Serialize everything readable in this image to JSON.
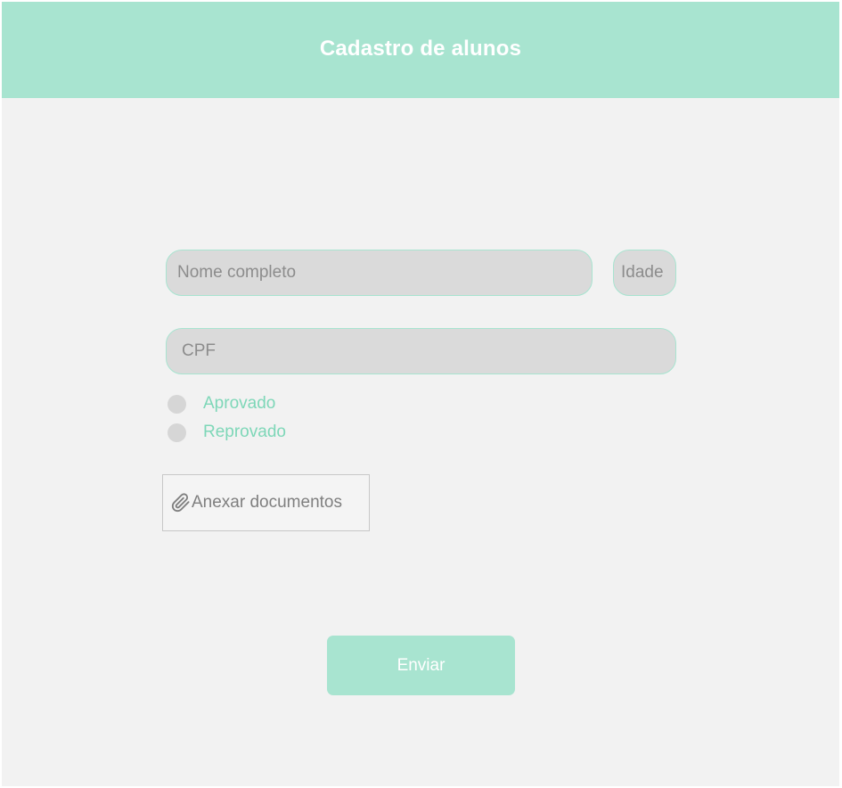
{
  "header": {
    "title": "Cadastro de alunos"
  },
  "form": {
    "name_placeholder": "Nome completo",
    "name_value": "",
    "age_placeholder": "Idade",
    "age_value": "",
    "cpf_placeholder": "CPF",
    "cpf_value": "",
    "status_options": [
      {
        "label": "Aprovado",
        "selected": false
      },
      {
        "label": "Reprovado",
        "selected": false
      }
    ],
    "attach_label": "Anexar documentos",
    "attach_icon": "paperclip-icon",
    "submit_label": "Enviar"
  },
  "colors": {
    "accent": "#a8e4d0",
    "accent_text": "#7ed7b8",
    "background": "#f2f2f2",
    "field_background": "#dadada",
    "placeholder_text": "#8c8c8c"
  }
}
